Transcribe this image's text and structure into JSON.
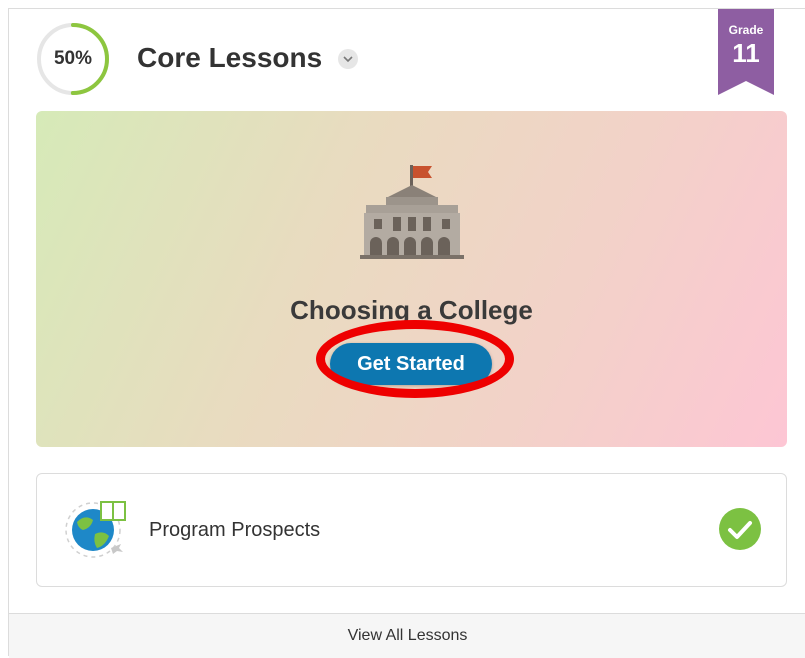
{
  "header": {
    "progress_percent": 50,
    "progress_label": "50%",
    "title": "Core Lessons",
    "grade_label": "Grade",
    "grade_number": "11"
  },
  "featured_lesson": {
    "icon": "college-building-icon",
    "title": "Choosing a College",
    "button_label": "Get Started"
  },
  "lessons": [
    {
      "icon": "globe-book-icon",
      "label": "Program Prospects",
      "status": "completed",
      "status_icon": "checkmark-circle-icon"
    }
  ],
  "footer": {
    "link_label": "View All Lessons"
  },
  "colors": {
    "progress": "#8dc63f",
    "grade_ribbon": "#8e5ea2",
    "cta": "#0d77b0",
    "check": "#7cc142",
    "annotation": "#ee0000"
  }
}
